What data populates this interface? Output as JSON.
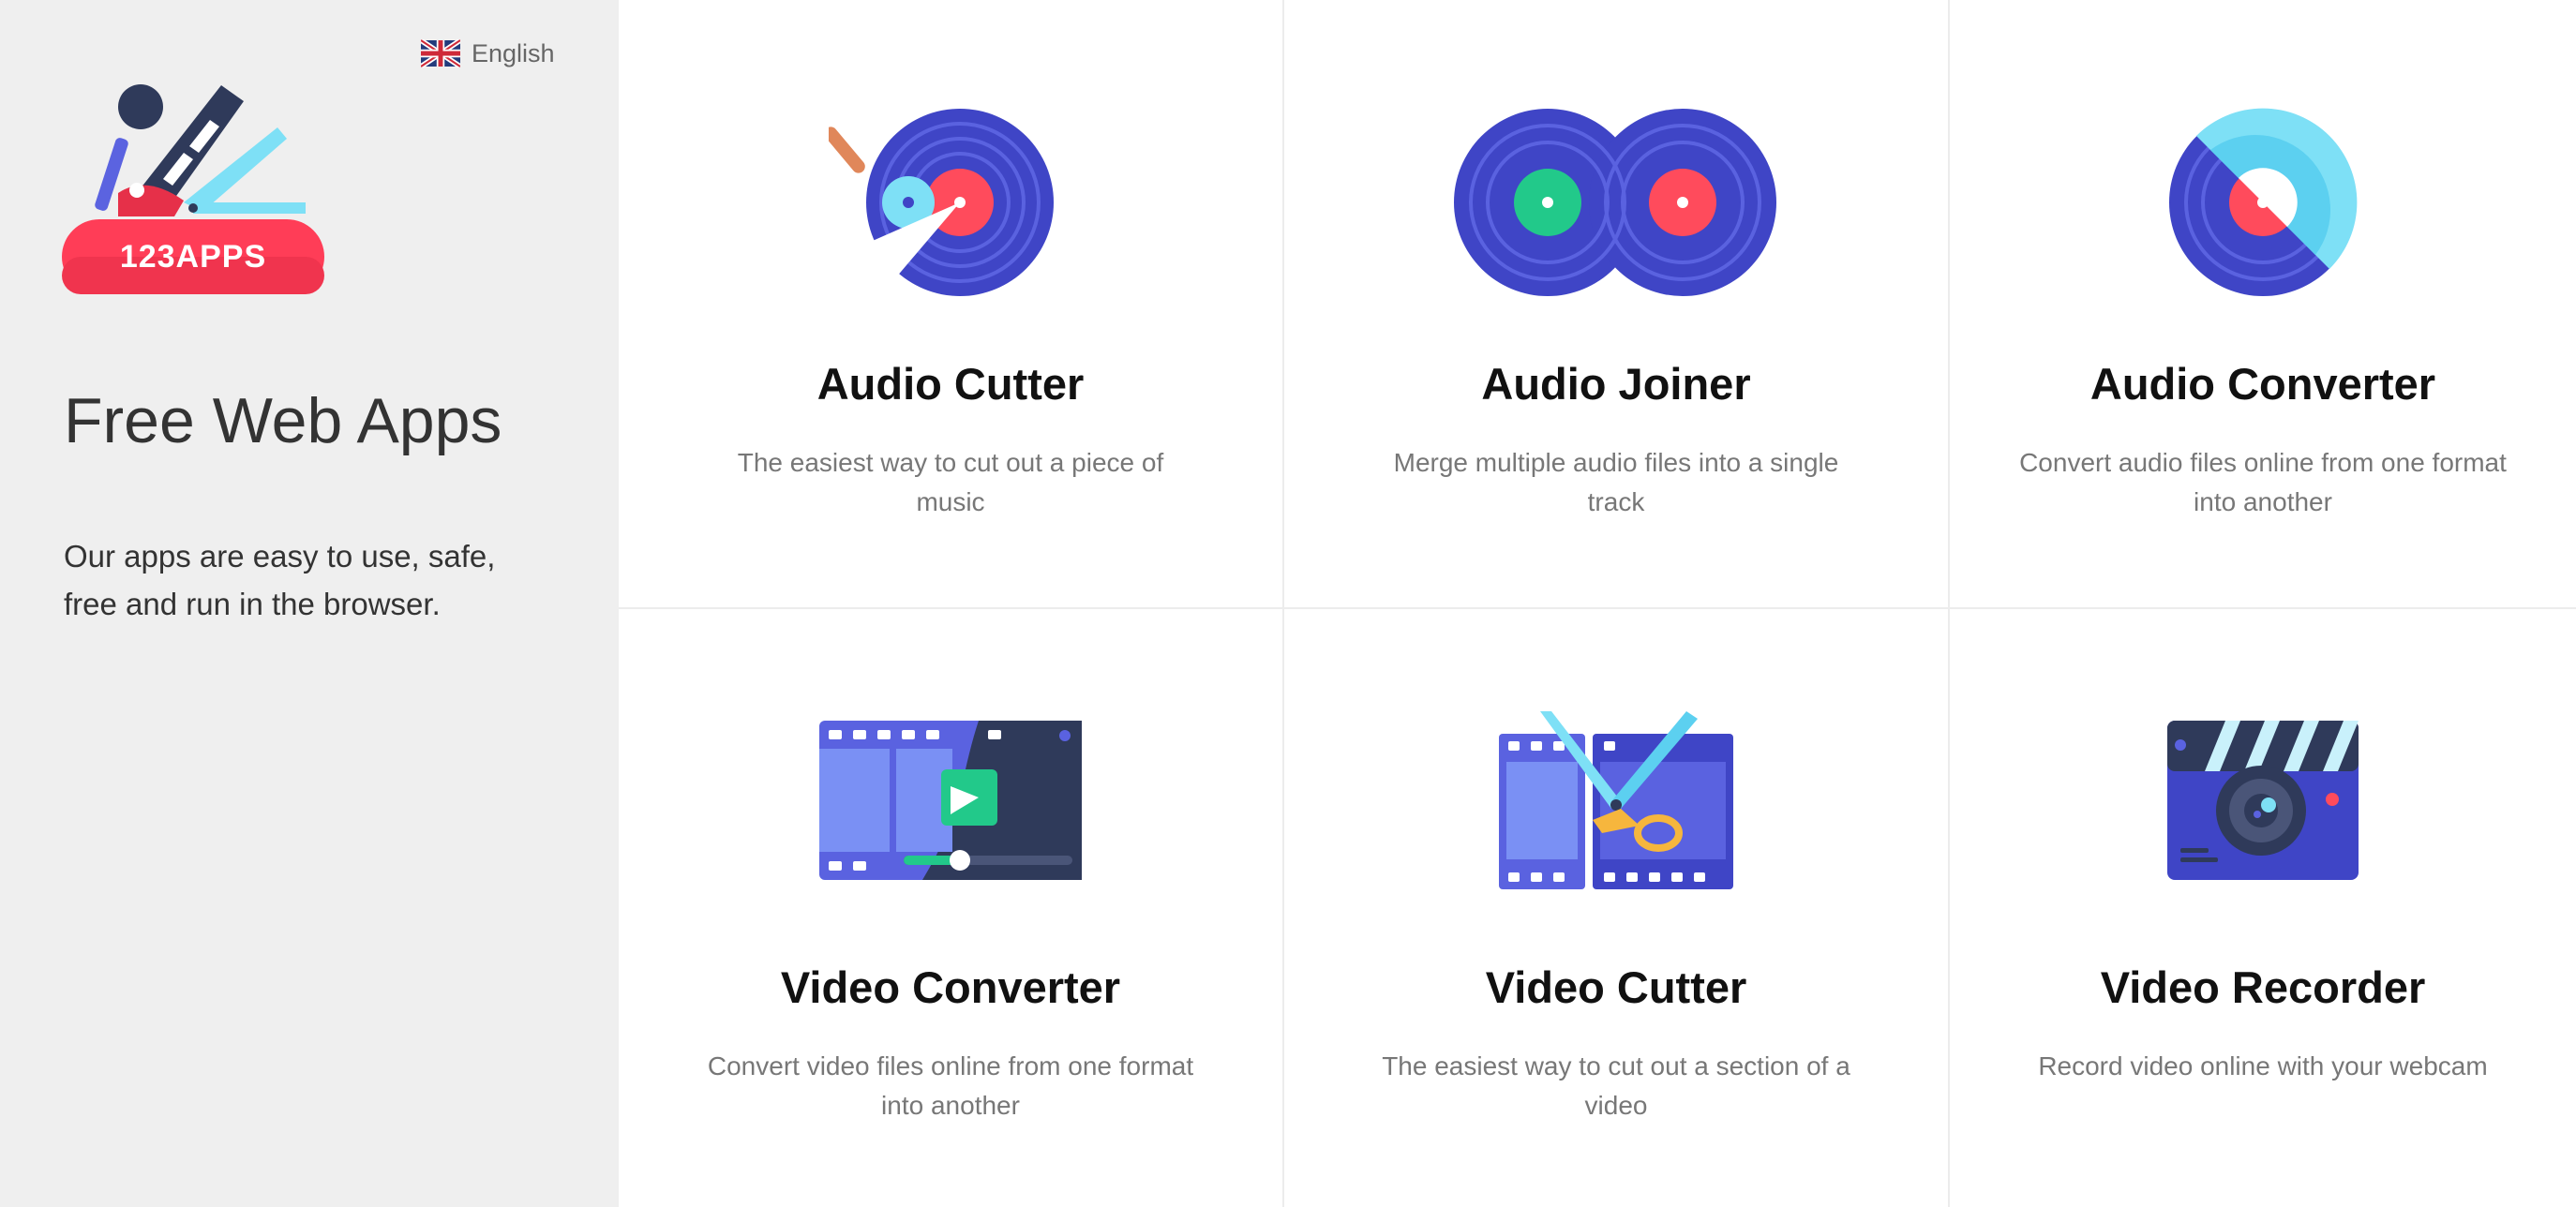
{
  "language": {
    "label": "English"
  },
  "brand": {
    "logo_text": "123APPS"
  },
  "hero": {
    "title": "Free Web Apps",
    "subtitle": "Our apps are easy to use, safe, free and run in the browser."
  },
  "apps": [
    {
      "title": "Audio Cutter",
      "description": "The easiest way to cut out a piece of music"
    },
    {
      "title": "Audio Joiner",
      "description": "Merge multiple audio files into a single track"
    },
    {
      "title": "Audio Converter",
      "description": "Convert audio files online from one format into another"
    },
    {
      "title": "Video Converter",
      "description": "Convert video files online from one format into another"
    },
    {
      "title": "Video Cutter",
      "description": "The easiest way to cut out a section of a video"
    },
    {
      "title": "Video Recorder",
      "description": "Record video online with your webcam"
    }
  ],
  "colors": {
    "sidebar_bg": "#efefef",
    "brand_red": "#ff3d57",
    "record_blue": "#3f45c6",
    "accent_green": "#22c98a",
    "accent_cyan": "#7ee0f6"
  }
}
